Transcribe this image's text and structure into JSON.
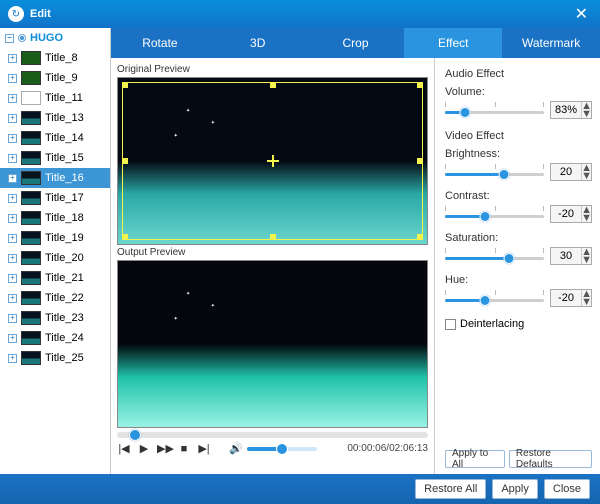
{
  "window": {
    "title": "Edit"
  },
  "tree": {
    "root_label": "HUGO",
    "items": [
      {
        "label": "Title_8",
        "thumb": "green"
      },
      {
        "label": "Title_9",
        "thumb": "green"
      },
      {
        "label": "Title_11",
        "thumb": "white"
      },
      {
        "label": "Title_13",
        "thumb": "clouds"
      },
      {
        "label": "Title_14",
        "thumb": "clouds"
      },
      {
        "label": "Title_15",
        "thumb": "clouds"
      },
      {
        "label": "Title_16",
        "thumb": "clouds",
        "selected": true
      },
      {
        "label": "Title_17",
        "thumb": "clouds"
      },
      {
        "label": "Title_18",
        "thumb": "clouds"
      },
      {
        "label": "Title_19",
        "thumb": "clouds"
      },
      {
        "label": "Title_20",
        "thumb": "clouds"
      },
      {
        "label": "Title_21",
        "thumb": "clouds"
      },
      {
        "label": "Title_22",
        "thumb": "clouds"
      },
      {
        "label": "Title_23",
        "thumb": "clouds"
      },
      {
        "label": "Title_24",
        "thumb": "clouds"
      },
      {
        "label": "Title_25",
        "thumb": "clouds"
      }
    ]
  },
  "tabs": {
    "items": [
      "Rotate",
      "3D",
      "Crop",
      "Effect",
      "Watermark"
    ],
    "active_index": 3
  },
  "preview": {
    "original_label": "Original Preview",
    "output_label": "Output Preview"
  },
  "transport": {
    "progress_percent": 4,
    "volume_percent": 50,
    "time": "00:00:06/02:06:13"
  },
  "effects": {
    "audio_section": "Audio Effect",
    "video_section": "Video Effect",
    "volume_label": "Volume:",
    "volume_value": "83%",
    "volume_slider_percent": 20,
    "brightness_label": "Brightness:",
    "brightness_value": "20",
    "brightness_slider_percent": 60,
    "contrast_label": "Contrast:",
    "contrast_value": "-20",
    "contrast_slider_percent": 40,
    "saturation_label": "Saturation:",
    "saturation_value": "30",
    "saturation_slider_percent": 65,
    "hue_label": "Hue:",
    "hue_value": "-20",
    "hue_slider_percent": 40,
    "deinterlacing_label": "Deinterlacing"
  },
  "buttons": {
    "apply_to_all": "Apply to All",
    "restore_defaults": "Restore Defaults",
    "restore_all": "Restore All",
    "apply": "Apply",
    "close": "Close"
  }
}
